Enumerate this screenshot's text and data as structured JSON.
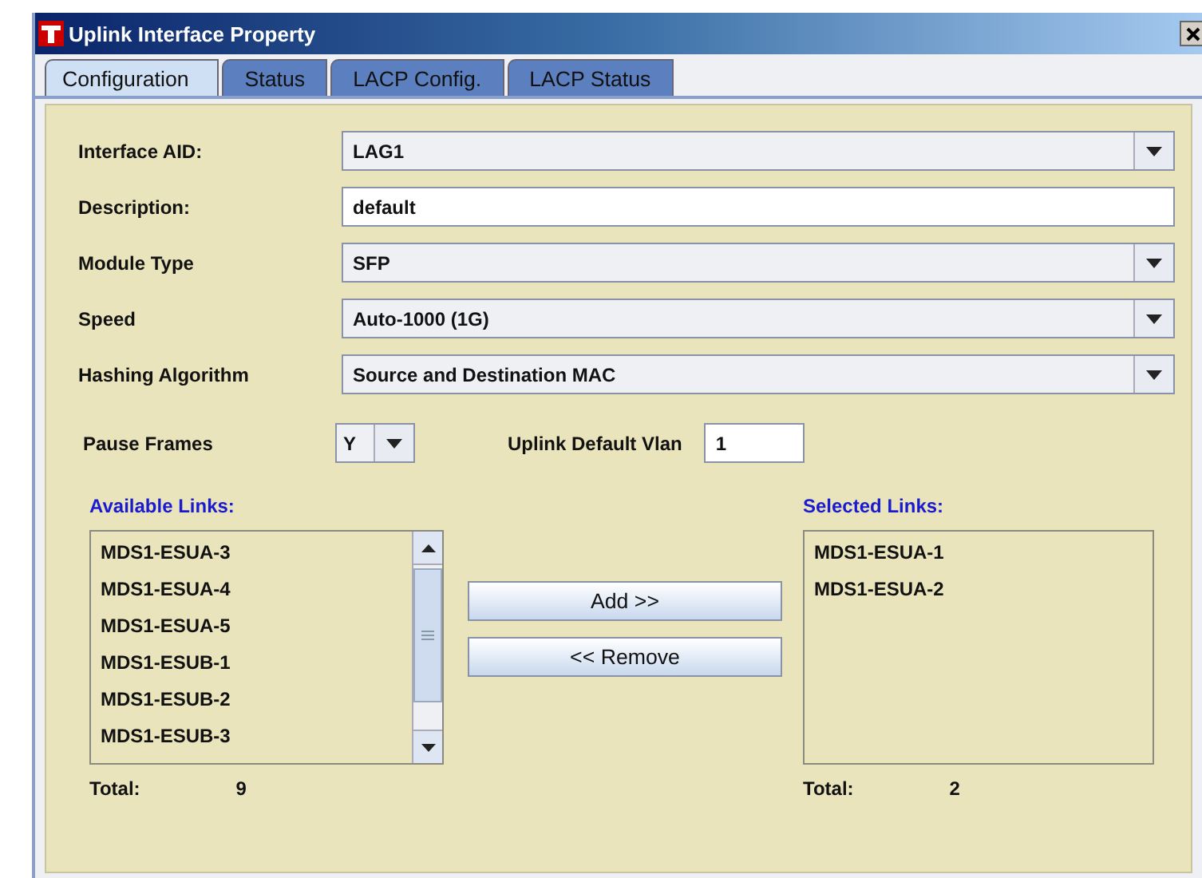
{
  "window": {
    "title": "Uplink Interface Property"
  },
  "tabs": [
    {
      "label": "Configuration",
      "selected": true
    },
    {
      "label": "Status",
      "selected": false
    },
    {
      "label": "LACP Config.",
      "selected": false
    },
    {
      "label": "LACP Status",
      "selected": false
    }
  ],
  "fields": [
    {
      "label": "Interface AID:",
      "kind": "combo",
      "value": "LAG1"
    },
    {
      "label": "Description:",
      "kind": "text",
      "value": "default"
    },
    {
      "label": "Module Type",
      "kind": "combo",
      "value": "SFP"
    },
    {
      "label": "Speed",
      "kind": "combo",
      "value": "Auto-1000 (1G)"
    },
    {
      "label": "Hashing Algorithm",
      "kind": "combo",
      "value": "Source and Destination MAC"
    }
  ],
  "pause_frames": {
    "label": "Pause Frames",
    "value": "Y"
  },
  "uplink_default_vlan": {
    "label": "Uplink Default Vlan",
    "value": "1"
  },
  "available_links": {
    "title": "Available Links:",
    "items": [
      "MDS1-ESUA-3",
      "MDS1-ESUA-4",
      "MDS1-ESUA-5",
      "MDS1-ESUB-1",
      "MDS1-ESUB-2",
      "MDS1-ESUB-3"
    ],
    "total_label": "Total:",
    "total": "9"
  },
  "buttons": [
    "Add >>",
    "<< Remove"
  ],
  "selected_links": {
    "title": "Selected Links:",
    "items": [
      "MDS1-ESUA-1",
      "MDS1-ESUA-2"
    ],
    "total_label": "Total:",
    "total": "2"
  }
}
